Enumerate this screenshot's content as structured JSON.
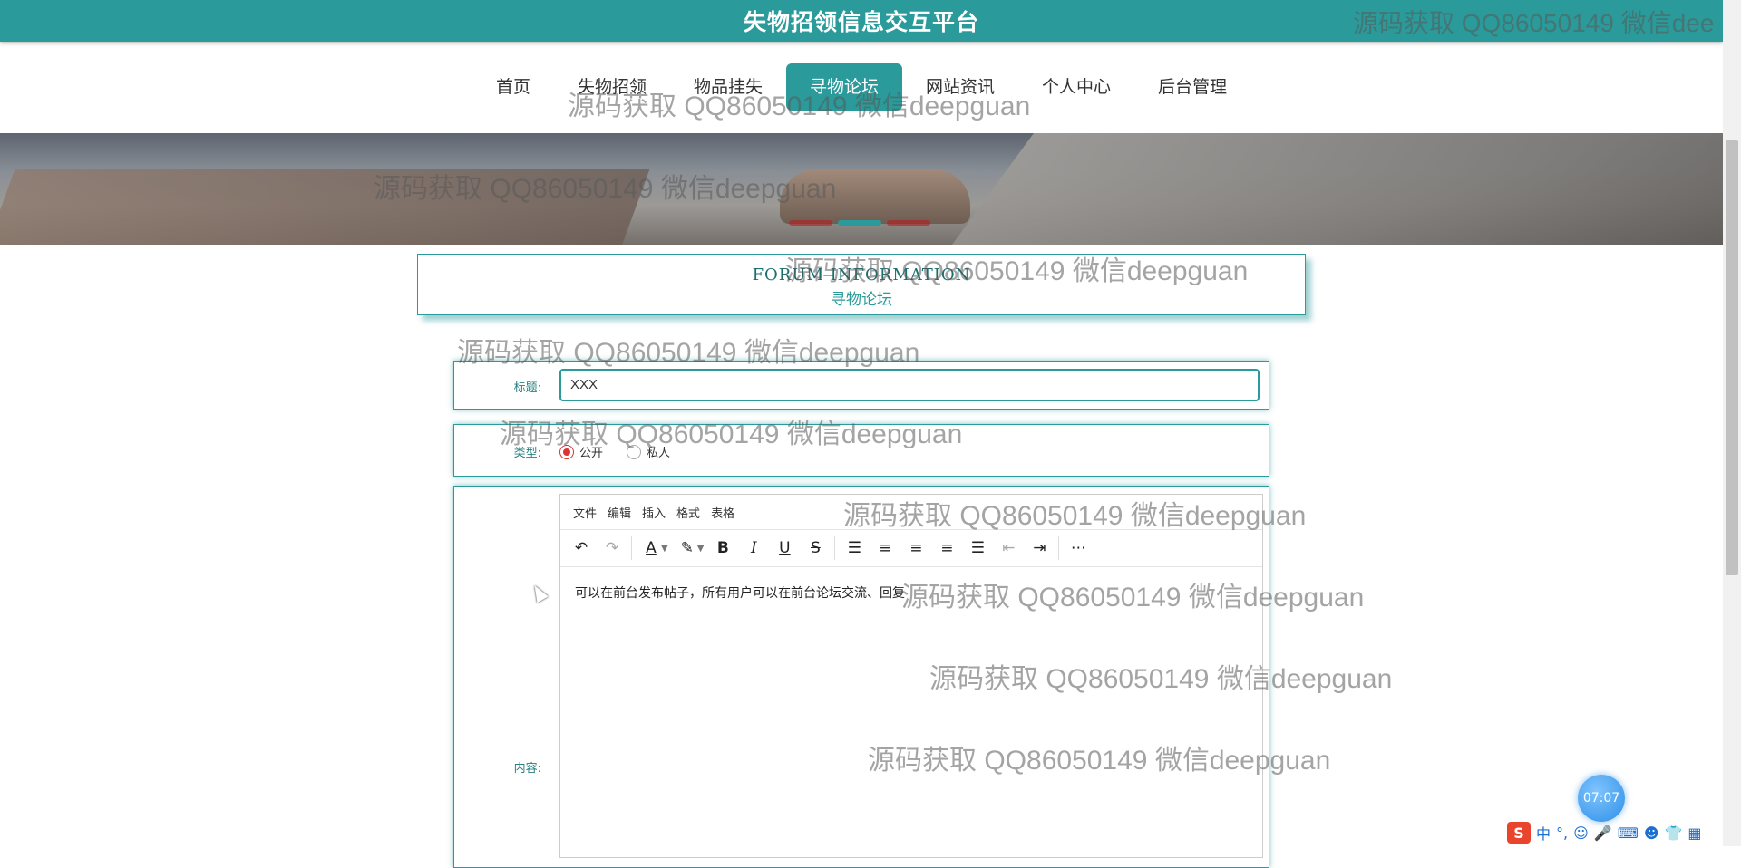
{
  "site_title": "失物招领信息交互平台",
  "nav": {
    "items": [
      "首页",
      "失物招领",
      "物品挂失",
      "寻物论坛",
      "网站资讯",
      "个人中心",
      "后台管理"
    ],
    "active": "寻物论坛"
  },
  "section": {
    "title_en": "FORUM INFORMATION",
    "title_cn": "寻物论坛"
  },
  "form": {
    "title_label": "标题:",
    "title_value": "XXX",
    "type_label": "类型:",
    "type_options": [
      "公开",
      "私人"
    ],
    "type_selected": "公开",
    "content_label": "内容:",
    "editor": {
      "menu": [
        "文件",
        "编辑",
        "插入",
        "格式",
        "表格"
      ],
      "toolbar_icons": [
        "undo-icon",
        "redo-icon",
        "text-color-icon",
        "highlight-color-icon",
        "bold-icon",
        "italic-icon",
        "underline-icon",
        "strikethrough-icon",
        "list-icon",
        "align-left-icon",
        "align-center-icon",
        "align-right-icon",
        "align-justify-icon",
        "outdent-icon",
        "indent-icon",
        "more-icon"
      ],
      "content": "可以在前台发布帖子，所有用户可以在前台论坛交流、回复"
    }
  },
  "watermark": "源码获取 QQ86050149 微信deepguan",
  "watermark_top_right": "源码获取 QQ86050149 微信dee",
  "clock": "07:07",
  "ime": {
    "logo": "S",
    "lang": "中"
  },
  "colors": {
    "primary": "#2a9a9a",
    "active_nav_text": "#ffffff",
    "radio_checked": "#dd3333"
  }
}
